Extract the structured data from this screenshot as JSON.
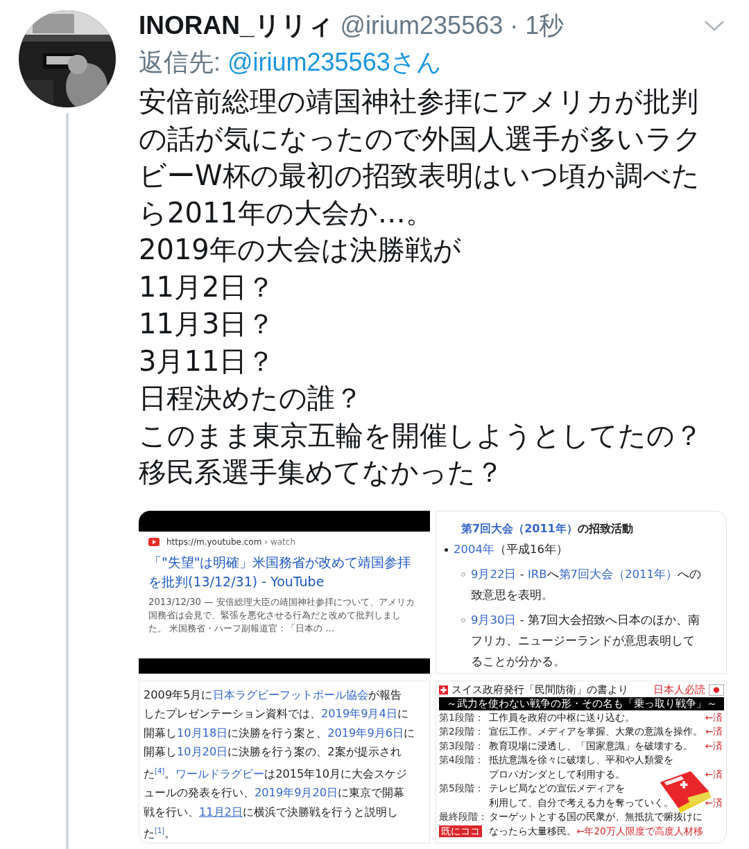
{
  "tweet": {
    "name": "INORAN_リリィ",
    "handle": "@irium235563",
    "separator": "·",
    "time": "1秒",
    "reply_label": "返信先:",
    "reply_to": "@irium235563さん",
    "body": [
      "安倍前総理の靖国神社参拝にアメリカが批判の話が気になったので外国人選手が多いラクビーW杯の最初の招致表明はいつ頃か調べたら2011年の大会か…。",
      "2019年の大会は決勝戦が",
      "11月2日？",
      "11月3日？",
      "3月11日？",
      "日程決めたの誰？",
      "このまま東京五輪を開催しようとしてたの？",
      "移民系選手集めてなかった？"
    ]
  },
  "media": [
    {
      "kind": "search_result",
      "url": "https://m.youtube.com",
      "path": "› watch",
      "title": "「\"失望\"は明確」米国務省が改めて靖国参拝を批判(13/12/31) - YouTube",
      "snippet": "2013/12/30 — 安倍総理大臣の靖国神社参拝について、アメリカ国務省は会見で、緊張を悪化させる行為だと改めて批判しました。 米国務省・ハーフ副報道官：「日本の ..."
    },
    {
      "kind": "wiki_list",
      "heading": [
        {
          "text": "第7回大会（2011年）",
          "kind": "link"
        },
        {
          "text": "の招致活動",
          "kind": "text"
        }
      ],
      "items": [
        {
          "lines": [
            [
              {
                "text": "2004年",
                "kind": "link"
              },
              {
                "text": "（平成16年）",
                "kind": "text"
              }
            ]
          ],
          "children": [
            {
              "lines": [
                [
                  {
                    "text": "9月22日",
                    "kind": "link"
                  },
                  {
                    "text": " - ",
                    "kind": "text"
                  },
                  {
                    "text": "IRB",
                    "kind": "link"
                  },
                  {
                    "text": "へ",
                    "kind": "text"
                  },
                  {
                    "text": "第7回大会（2011年）",
                    "kind": "link"
                  },
                  {
                    "text": "への",
                    "kind": "text"
                  }
                ],
                [
                  {
                    "text": "致意思を表明。",
                    "kind": "text"
                  }
                ]
              ]
            },
            {
              "lines": [
                [
                  {
                    "text": "9月30日",
                    "kind": "link"
                  },
                  {
                    "text": " - 第7回大会招致へ日本のほか、南",
                    "kind": "text"
                  }
                ],
                [
                  {
                    "text": "フリカ、ニュージーランドが意思表明して",
                    "kind": "text"
                  }
                ],
                [
                  {
                    "text": "ることが分かる。",
                    "kind": "text"
                  }
                ]
              ]
            }
          ]
        }
      ]
    },
    {
      "kind": "wiki_paragraph",
      "lines": [
        [
          {
            "text": "2009年5月に",
            "kind": "text"
          },
          {
            "text": "日本ラグビーフットボール協会",
            "kind": "link"
          },
          {
            "text": "が報告",
            "kind": "text"
          }
        ],
        [
          {
            "text": "したプレゼンテーション資料では、",
            "kind": "text"
          },
          {
            "text": "2019年9月4日",
            "kind": "link"
          },
          {
            "text": "に",
            "kind": "text"
          }
        ],
        [
          {
            "text": "開幕し",
            "kind": "text"
          },
          {
            "text": "10月18日",
            "kind": "link"
          },
          {
            "text": "に決勝を行う案と、",
            "kind": "text"
          },
          {
            "text": "2019年9月6日",
            "kind": "link"
          },
          {
            "text": "に",
            "kind": "text"
          }
        ],
        [
          {
            "text": "開幕し",
            "kind": "text"
          },
          {
            "text": "10月20日",
            "kind": "link"
          },
          {
            "text": "に決勝を行う案の、2案が提示され",
            "kind": "text"
          }
        ],
        [
          {
            "text": "た",
            "kind": "text"
          },
          {
            "text": "[4]",
            "kind": "ref"
          },
          {
            "text": "。",
            "kind": "text"
          },
          {
            "text": "ワールドラグビー",
            "kind": "link"
          },
          {
            "text": "は2015年10月に大会スケジ",
            "kind": "text"
          }
        ],
        [
          {
            "text": "ュールの発表を行い、",
            "kind": "text"
          },
          {
            "text": "2019年9月20日",
            "kind": "link"
          },
          {
            "text": "に東京で開幕",
            "kind": "text"
          }
        ],
        [
          {
            "text": "戦を行い、",
            "kind": "text"
          },
          {
            "text": "11月2日",
            "kind": "active_link"
          },
          {
            "text": "に横浜で決勝戦を行うと説明し",
            "kind": "text"
          }
        ],
        [
          {
            "text": "た",
            "kind": "text"
          },
          {
            "text": "[1]",
            "kind": "ref"
          },
          {
            "text": "。",
            "kind": "text"
          }
        ]
      ]
    },
    {
      "kind": "poster",
      "title": "スイス政府発行「民間防衛」の書より",
      "must_read": "日本人必読",
      "banner": "～武力を使わない戦争の形・その名も「乗っ取り戦争」～",
      "rows": [
        {
          "label": "第1段階：",
          "lines": [
            "工作員を政府の中枢に送り込む。"
          ],
          "mark": "←済"
        },
        {
          "label": "第2段階：",
          "lines": [
            "宣伝工作。メディアを掌握、大衆の意識を操作。"
          ],
          "mark": "←済"
        },
        {
          "label": "第3段階：",
          "lines": [
            "教育現場に浸透し、「国家意識」を破壊する。"
          ],
          "mark": "←済"
        },
        {
          "label": "第4段階：",
          "lines": [
            "抵抗意識を徐々に破壊し、平和や人類愛を",
            "プロパガンダとして利用する。"
          ],
          "mark": "←済"
        },
        {
          "label": "第5段階：",
          "lines": [
            "テレビ局などの宣伝メディアを",
            "利用して、自分で考える力を奪っていく。"
          ],
          "mark": "←済"
        },
        {
          "label": "最終段階：",
          "lines": [
            "ターゲットとする国の民衆が、無抵抗で腑抜けに",
            "なったら大量移民。"
          ],
          "badge": "既にココ",
          "note": "←年20万人限度で高度人材移"
        }
      ]
    }
  ]
}
